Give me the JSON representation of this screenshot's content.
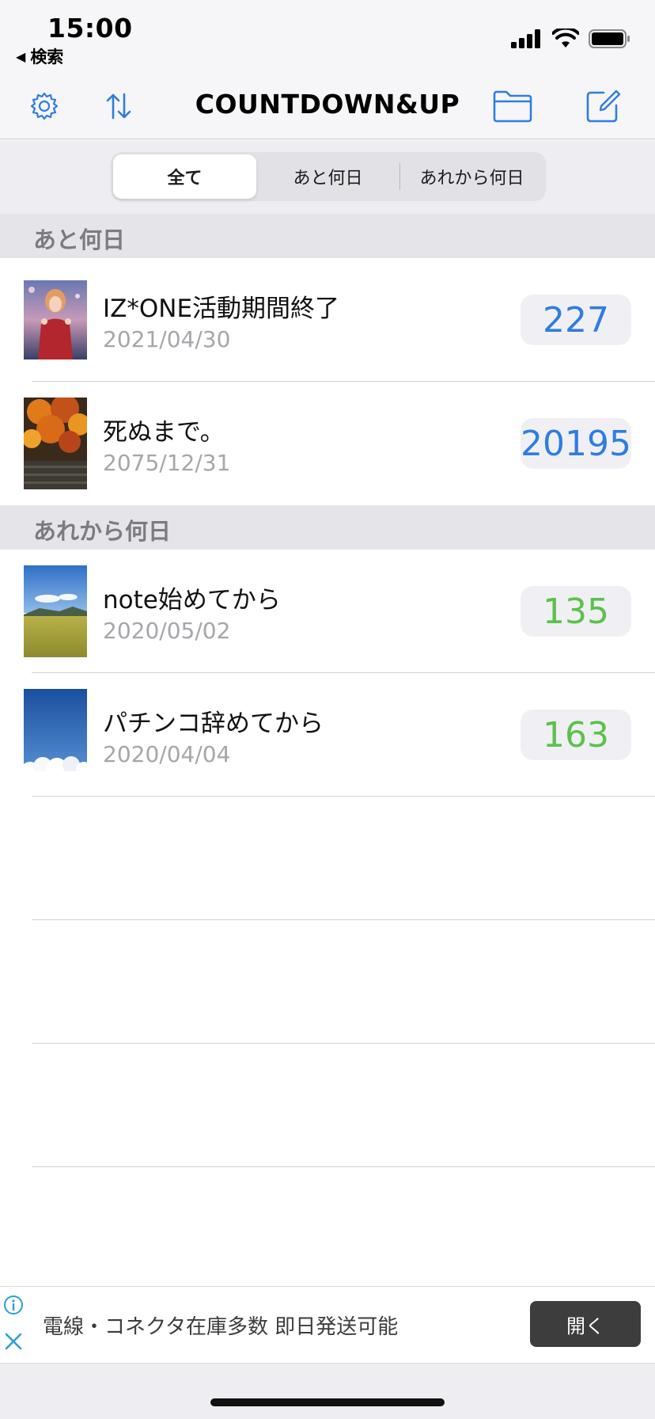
{
  "status_bar": {
    "time": "15:00",
    "back_app": "検索"
  },
  "nav": {
    "title": "COUNTDOWN&UP",
    "accent": "#2f7de0"
  },
  "segmented": [
    "全て",
    "あと何日",
    "あれから何日"
  ],
  "sections": [
    {
      "header": "あと何日",
      "items": [
        {
          "title": "IZ*ONE活動期間終了",
          "date": "2021/04/30",
          "count": "227",
          "color": "blue"
        },
        {
          "title": "死ぬまで。",
          "date": "2075/12/31",
          "count": "20195",
          "color": "blue"
        }
      ]
    },
    {
      "header": "あれから何日",
      "items": [
        {
          "title": "note始めてから",
          "date": "2020/05/02",
          "count": "135",
          "color": "green"
        },
        {
          "title": "パチンコ辞めてから",
          "date": "2020/04/04",
          "count": "163",
          "color": "green"
        }
      ]
    }
  ],
  "ad": {
    "text": "電線・コネクタ在庫多数 即日発送可能",
    "button": "開く"
  }
}
